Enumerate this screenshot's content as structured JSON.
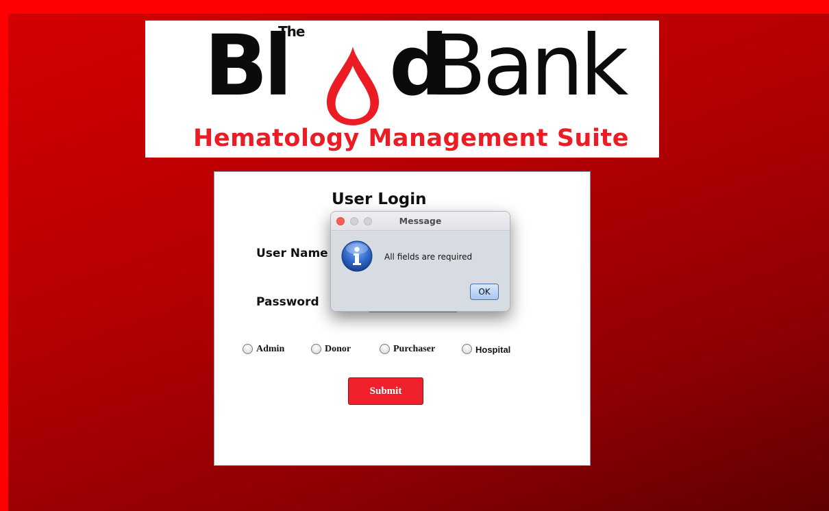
{
  "banner": {
    "logo": {
      "the": "The",
      "word_part1": "Bl",
      "word_part2": "d",
      "word_part3": "Bank"
    },
    "subtitle": "Hematology Management Suite"
  },
  "login": {
    "title": "User Login",
    "username_label": "User Name",
    "username_value": "",
    "password_label": "Password",
    "password_value": "",
    "roles": [
      {
        "label": "Admin",
        "selected": false
      },
      {
        "label": "Donor",
        "selected": false
      },
      {
        "label": "Purchaser",
        "selected": false
      },
      {
        "label": "Hospital",
        "selected": false
      }
    ],
    "submit_label": "Submit"
  },
  "dialog": {
    "title": "Message",
    "message": "All fields are required",
    "ok_label": "OK",
    "icon": "info-icon"
  },
  "colors": {
    "accent_red": "#ec1c24",
    "submit_red": "#f0202c",
    "background_red": "#b60003"
  }
}
